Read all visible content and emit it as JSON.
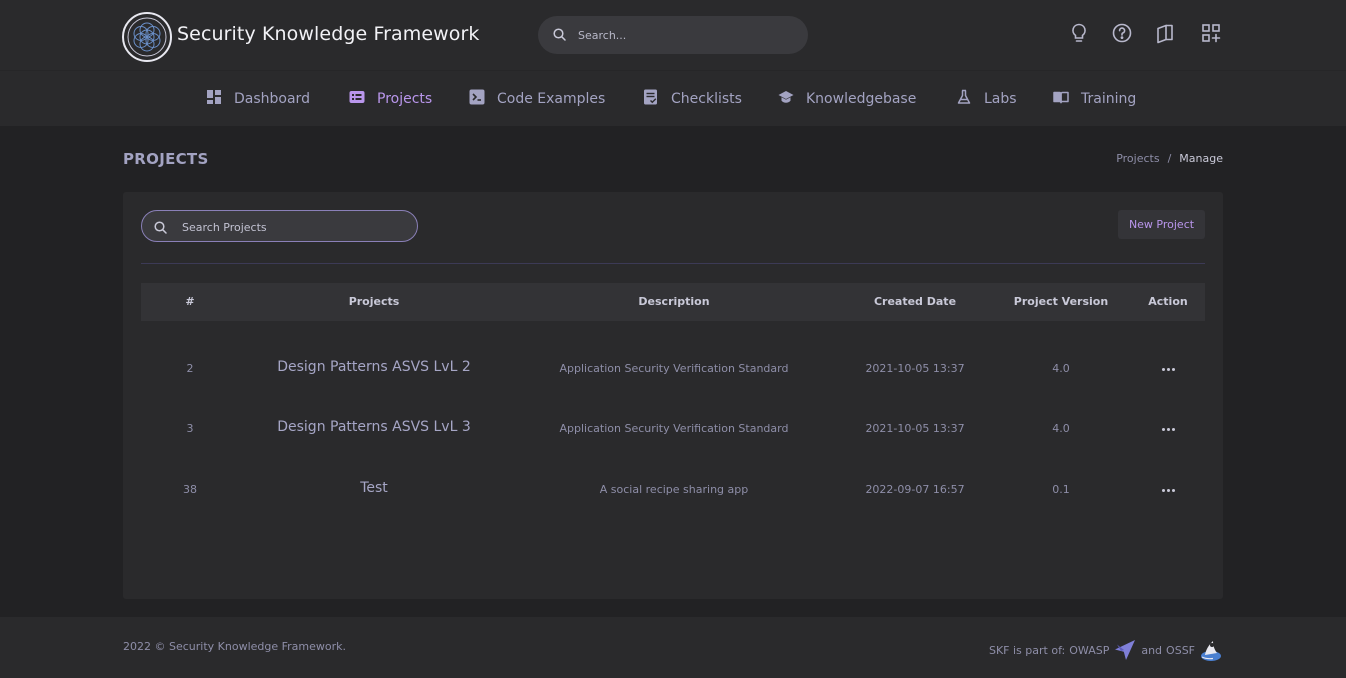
{
  "header": {
    "brand": "Security Knowledge Framework",
    "search_placeholder": "Search...",
    "icons": [
      "lightbulb-icon",
      "help-icon",
      "book-icon",
      "apps-icon"
    ]
  },
  "nav": {
    "items": [
      {
        "label": "Dashboard",
        "icon": "dashboard-icon"
      },
      {
        "label": "Projects",
        "icon": "projects-icon",
        "active": true
      },
      {
        "label": "Code Examples",
        "icon": "code-icon"
      },
      {
        "label": "Checklists",
        "icon": "checklist-icon"
      },
      {
        "label": "Knowledgebase",
        "icon": "knowledgebase-icon"
      },
      {
        "label": "Labs",
        "icon": "flask-icon"
      },
      {
        "label": "Training",
        "icon": "training-icon"
      }
    ]
  },
  "page": {
    "title": "PROJECTS",
    "breadcrumb": {
      "link": "Projects",
      "separator": "/",
      "current": "Manage"
    }
  },
  "projects": {
    "search_placeholder": "Search Projects",
    "new_button": "New Project",
    "columns": [
      "#",
      "Projects",
      "Description",
      "Created Date",
      "Project Version",
      "Action"
    ],
    "rows": [
      {
        "id": "2",
        "name": "Design Patterns ASVS LvL 2",
        "description": "Application Security Verification Standard",
        "created": "2021-10-05 13:37",
        "version": "4.0"
      },
      {
        "id": "3",
        "name": "Design Patterns ASVS LvL 3",
        "description": "Application Security Verification Standard",
        "created": "2021-10-05 13:37",
        "version": "4.0"
      },
      {
        "id": "38",
        "name": "Test",
        "description": "A social recipe sharing app",
        "created": "2022-09-07 16:57",
        "version": "0.1"
      }
    ]
  },
  "footer": {
    "copyright": "2022 © Security Knowledge Framework.",
    "part_of": "SKF is part of:",
    "owasp": "OWASP",
    "and": "and",
    "ossf": "OSSF"
  },
  "colors": {
    "accent": "#b996ec",
    "background": "#222224",
    "panel": "#2a2a2c"
  }
}
